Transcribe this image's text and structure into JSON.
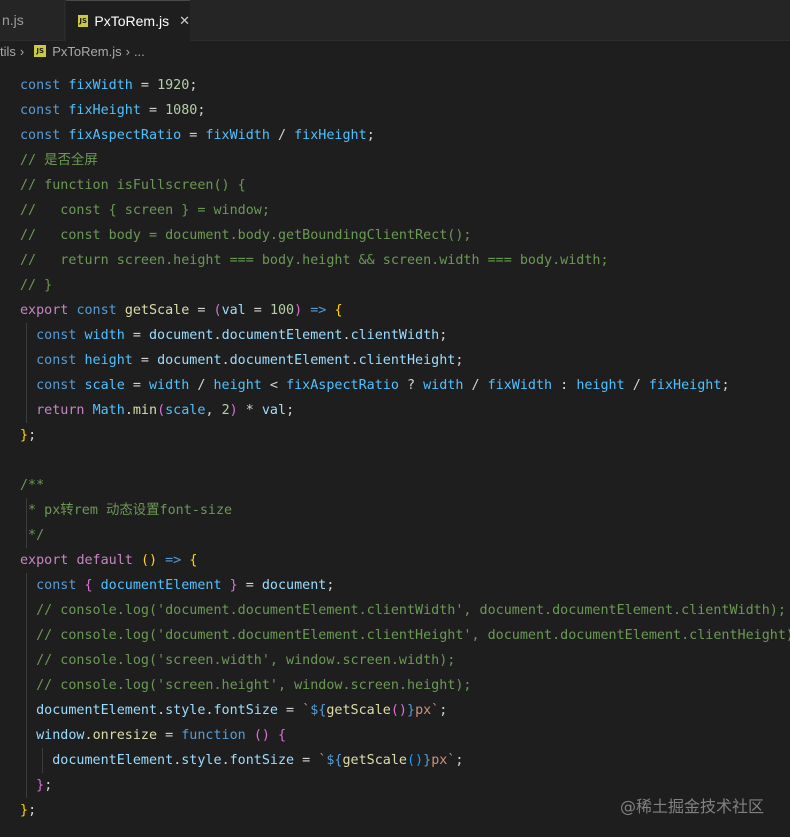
{
  "tabs": {
    "prev_label": "n.js",
    "active_label": "PxToRem.js",
    "active_close": "✕",
    "js_icon_text": "JS"
  },
  "breadcrumb": {
    "folder": "tils",
    "file": "PxToRem.js",
    "more": "..."
  },
  "code": {
    "l1": {
      "name": "fixWidth",
      "num": "1920"
    },
    "l2": {
      "name": "fixHeight",
      "num": "1080"
    },
    "l3": {
      "name": "fixAspectRatio",
      "a": "fixWidth",
      "b": "fixHeight"
    },
    "comments": [
      "// 是否全屏",
      "// function isFullscreen() {",
      "//   const { screen } = window;",
      "//   const body = document.body.getBoundingClientRect();",
      "//   return screen.height === body.height && screen.width === body.width;",
      "// }"
    ],
    "getScale": {
      "name": "getScale",
      "param": "val",
      "default": "100"
    },
    "block_comment": [
      "/**",
      " * px转rem 动态设置font-size",
      " */"
    ],
    "console_comments": [
      "// console.log('document.documentElement.clientWidth', document.documentElement.clientWidth);",
      "// console.log('document.documentElement.clientHeight', document.documentElement.clientHeight);",
      "// console.log('screen.width', window.screen.width);",
      "// console.log('screen.height', window.screen.height);"
    ]
  },
  "watermark": "@稀土掘金技术社区",
  "colors": {
    "background": "#1e1e1e",
    "keyword": "#569cd6",
    "variable": "#9cdcfe",
    "constant": "#4fc1ff",
    "number": "#b5cea8",
    "function": "#dcdcaa",
    "comment": "#6a9955",
    "js_badge": "#cbcb41"
  }
}
